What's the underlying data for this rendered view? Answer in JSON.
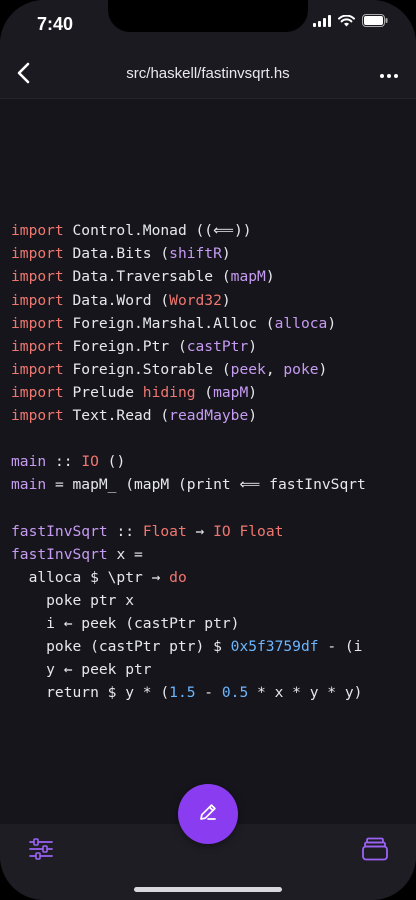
{
  "status": {
    "time": "7:40"
  },
  "nav": {
    "title": "src/haskell/fastinvsqrt.hs"
  },
  "colors": {
    "keyword": "#f0776f",
    "function": "#c69cf2",
    "number": "#6cb6ff",
    "text": "#e7e7ee",
    "accent": "#8a3df0",
    "background": "#16151c"
  },
  "icons": {
    "back": "chevron-left-icon",
    "more": "ellipsis-icon",
    "edit": "pencil-icon",
    "settings": "sliders-icon",
    "files": "stack-icon"
  },
  "code": {
    "lines": [
      [],
      [],
      [],
      [
        {
          "t": "import",
          "c": "kw"
        },
        {
          "t": " Control.Monad ((⟸))",
          "c": ""
        }
      ],
      [
        {
          "t": "import",
          "c": "kw"
        },
        {
          "t": " Data.Bits (",
          "c": ""
        },
        {
          "t": "shiftR",
          "c": "fn"
        },
        {
          "t": ")",
          "c": ""
        }
      ],
      [
        {
          "t": "import",
          "c": "kw"
        },
        {
          "t": " Data.Traversable (",
          "c": ""
        },
        {
          "t": "mapM",
          "c": "fn"
        },
        {
          "t": ")",
          "c": ""
        }
      ],
      [
        {
          "t": "import",
          "c": "kw"
        },
        {
          "t": " Data.Word (",
          "c": ""
        },
        {
          "t": "Word32",
          "c": "kw"
        },
        {
          "t": ")",
          "c": ""
        }
      ],
      [
        {
          "t": "import",
          "c": "kw"
        },
        {
          "t": " Foreign.Marshal.Alloc (",
          "c": ""
        },
        {
          "t": "alloca",
          "c": "fn"
        },
        {
          "t": ")",
          "c": ""
        }
      ],
      [
        {
          "t": "import",
          "c": "kw"
        },
        {
          "t": " Foreign.Ptr (",
          "c": ""
        },
        {
          "t": "castPtr",
          "c": "fn"
        },
        {
          "t": ")",
          "c": ""
        }
      ],
      [
        {
          "t": "import",
          "c": "kw"
        },
        {
          "t": " Foreign.Storable (",
          "c": ""
        },
        {
          "t": "peek",
          "c": "fn"
        },
        {
          "t": ", ",
          "c": ""
        },
        {
          "t": "poke",
          "c": "fn"
        },
        {
          "t": ")",
          "c": ""
        }
      ],
      [
        {
          "t": "import",
          "c": "kw"
        },
        {
          "t": " Prelude ",
          "c": ""
        },
        {
          "t": "hiding",
          "c": "kw"
        },
        {
          "t": " (",
          "c": ""
        },
        {
          "t": "mapM",
          "c": "fn"
        },
        {
          "t": ")",
          "c": ""
        }
      ],
      [
        {
          "t": "import",
          "c": "kw"
        },
        {
          "t": " Text.Read (",
          "c": ""
        },
        {
          "t": "readMaybe",
          "c": "fn"
        },
        {
          "t": ")",
          "c": ""
        }
      ],
      [],
      [
        {
          "t": "main",
          "c": "fn"
        },
        {
          "t": " :: ",
          "c": ""
        },
        {
          "t": "IO",
          "c": "kw"
        },
        {
          "t": " ()",
          "c": ""
        }
      ],
      [
        {
          "t": "main",
          "c": "fn"
        },
        {
          "t": " = mapM_ (mapM (print ⟸ fastInvSqrt",
          "c": ""
        }
      ],
      [],
      [
        {
          "t": "fastInvSqrt",
          "c": "fn"
        },
        {
          "t": " :: ",
          "c": ""
        },
        {
          "t": "Float",
          "c": "kw"
        },
        {
          "t": " → ",
          "c": ""
        },
        {
          "t": "IO Float",
          "c": "kw"
        }
      ],
      [
        {
          "t": "fastInvSqrt",
          "c": "fn"
        },
        {
          "t": " x =",
          "c": ""
        }
      ],
      [
        {
          "t": "  alloca $ \\ptr → ",
          "c": ""
        },
        {
          "t": "do",
          "c": "kw"
        }
      ],
      [
        {
          "t": "    poke ptr x",
          "c": ""
        }
      ],
      [
        {
          "t": "    i ← peek (castPtr ptr)",
          "c": ""
        }
      ],
      [
        {
          "t": "    poke (castPtr ptr) $ ",
          "c": ""
        },
        {
          "t": "0x5f3759df",
          "c": "num"
        },
        {
          "t": " - (i",
          "c": ""
        }
      ],
      [
        {
          "t": "    y ← peek ptr",
          "c": ""
        }
      ],
      [
        {
          "t": "    return $ y * (",
          "c": ""
        },
        {
          "t": "1.5",
          "c": "num"
        },
        {
          "t": " - ",
          "c": ""
        },
        {
          "t": "0.5",
          "c": "num"
        },
        {
          "t": " * x * y * y)",
          "c": ""
        }
      ]
    ]
  }
}
